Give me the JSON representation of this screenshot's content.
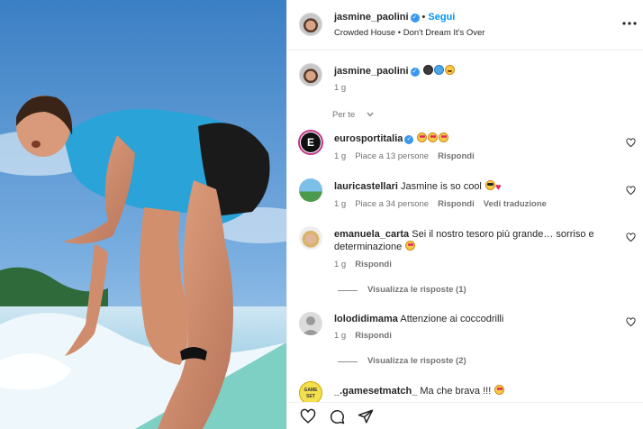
{
  "post": {
    "author": "jasmine_paolini",
    "follow_label": "Segui",
    "dot": "•",
    "audio": "Crowded House • Don't Dream It's Over",
    "more_icon": "more-horizontal-icon"
  },
  "caption": {
    "author": "jasmine_paolini",
    "emojis": [
      "surfer-emoji",
      "wave-emoji",
      "grin-emoji"
    ],
    "time": "1 g"
  },
  "sort_label": "Per te",
  "comments": [
    {
      "user": "eurosportitalia",
      "verified": true,
      "text": "",
      "emojis": [
        "heart-eyes-emoji",
        "heart-eyes-emoji",
        "heart-eyes-emoji"
      ],
      "time": "1 g",
      "likes": "Piace a 13 persone",
      "reply": "Rispondi"
    },
    {
      "user": "lauricastellari",
      "text": "Jasmine is so cool",
      "emojis": [
        "cool-emoji",
        "red-heart-emoji"
      ],
      "time": "1 g",
      "likes": "Piace a 34 persone",
      "reply": "Rispondi",
      "translate": "Vedi traduzione"
    },
    {
      "user": "emanuela_carta",
      "text": "Sei il nostro tesoro più grande… sorriso e",
      "text2": "determinazione",
      "emojis": [
        "heart-eyes-emoji"
      ],
      "time": "1 g",
      "reply": "Rispondi",
      "view_replies": "Visualizza le risposte (1)"
    },
    {
      "user": "lolodidimama",
      "text": "Attenzione ai coccodrilli",
      "time": "1 g",
      "reply": "Rispondi",
      "view_replies": "Visualizza le risposte (2)"
    },
    {
      "user": "_.gamesetmatch_",
      "text": "Ma che brava !!!",
      "emojis": [
        "heart-eyes-emoji"
      ]
    }
  ],
  "actions": [
    "heart-icon",
    "comment-icon",
    "share-icon"
  ],
  "colors": {
    "accent": "#0095f6",
    "verified": "#3897f0",
    "text": "#262626",
    "muted": "#737373"
  }
}
